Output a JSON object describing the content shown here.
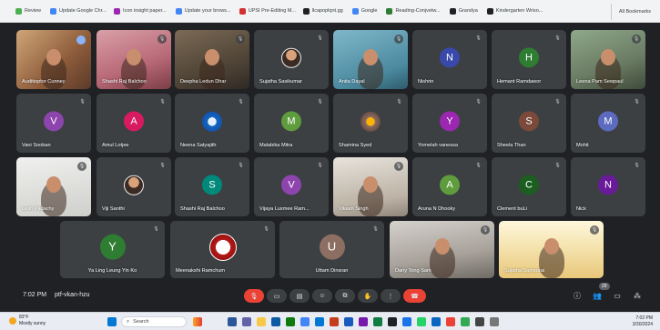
{
  "bookmarks": [
    {
      "label": "Review",
      "color": "#4caf50"
    },
    {
      "label": "Update Google Chr...",
      "color": "#4285f4"
    },
    {
      "label": "Icon insight paper...",
      "color": "#9c27b0"
    },
    {
      "label": "Update your brows...",
      "color": "#4285f4"
    },
    {
      "label": "UPSI Pre-Editing M...",
      "color": "#d32f2f"
    },
    {
      "label": "llcapoplqnt.gg",
      "color": "#202124"
    },
    {
      "label": "Google",
      "color": "#4285f4"
    },
    {
      "label": "Reading-Conjvetw...",
      "color": "#2e7d32"
    },
    {
      "label": "Grandya",
      "color": "#202124"
    },
    {
      "label": "Kindergarten Wriso...",
      "color": "#202124"
    }
  ],
  "all_bookmarks": "All Bookmarks",
  "participants": [
    {
      "name": "Auditioptor Cunney",
      "initial": "",
      "color": "",
      "video": "v-warm",
      "pin": true
    },
    {
      "name": "Shashi Raj Balchoo",
      "initial": "",
      "color": "",
      "video": "v-pink"
    },
    {
      "name": "Deepha Ledun Dhar",
      "initial": "",
      "color": "",
      "video": "v-room"
    },
    {
      "name": "Sujatha Sasikumar",
      "initial": "",
      "color": "",
      "video": "avatar-photo"
    },
    {
      "name": "Anita Dayal",
      "initial": "",
      "color": "",
      "video": "v-teal"
    },
    {
      "name": "Nishrin",
      "initial": "N",
      "color": "#3949ab"
    },
    {
      "name": "Hemant Ramdawor",
      "initial": "H",
      "color": "#2e7d32"
    },
    {
      "name": "Leena Pam Sewpaul",
      "initial": "",
      "color": "",
      "video": "v-plant"
    },
    {
      "name": "Vani Sooban",
      "initial": "V",
      "color": "#8e44ad"
    },
    {
      "name": "Amul Lotjee",
      "initial": "A",
      "color": "#d81b60"
    },
    {
      "name": "Neena Satyajith",
      "initial": "",
      "color": "",
      "video": "avatar-logo"
    },
    {
      "name": "Malabika Mitra",
      "initial": "M",
      "color": "#5f9c3d"
    },
    {
      "name": "Shamina Syed",
      "initial": "",
      "color": "",
      "video": "avatar-flower"
    },
    {
      "name": "Yomelah vanessa",
      "initial": "Y",
      "color": "#9c27b0"
    },
    {
      "name": "Sheela Than",
      "initial": "S",
      "color": "#7b4a3a"
    },
    {
      "name": "Mohit",
      "initial": "M",
      "color": "#5c6bc0"
    },
    {
      "name": "Lesh Padachy",
      "initial": "",
      "color": "",
      "video": "v-white"
    },
    {
      "name": "Viji Santhi",
      "initial": "",
      "color": "",
      "video": "avatar-photo2"
    },
    {
      "name": "Shashi Raj Balchoo",
      "initial": "S",
      "color": "#00897b"
    },
    {
      "name": "Vijaya Luxmee Ram...",
      "initial": "V",
      "color": "#8e44ad"
    },
    {
      "name": "Vikash Singh",
      "initial": "",
      "color": "",
      "video": "v-sofa"
    },
    {
      "name": "Aruna N Dhooky",
      "initial": "A",
      "color": "#5f9c3d"
    },
    {
      "name": "Clement buLi",
      "initial": "C",
      "color": "#1b5e20"
    },
    {
      "name": "Nick",
      "initial": "N",
      "color": "#6a1b9a"
    },
    {
      "name": "Ya Ling Leung Yin Ko",
      "initial": "Y",
      "color": "#2e7d32"
    },
    {
      "name": "Meenakshi Ramchum",
      "initial": "",
      "color": "",
      "video": "avatar-crest"
    },
    {
      "name": "Uttam Dinsran",
      "initial": "U",
      "color": "#8d6e63"
    },
    {
      "name": "Dany Tong Sam",
      "initial": "",
      "color": "",
      "video": "v-corr"
    },
    {
      "name": "Sujatha Samsurai",
      "initial": "",
      "color": "",
      "video": "v-poster"
    }
  ],
  "controls": {
    "time": "7:02 PM",
    "meeting_code": "ptf-vkan-hzu",
    "participant_count": "29"
  },
  "taskbar": {
    "weather_temp": "83°F",
    "weather_desc": "Mostly sunny",
    "search": "Search",
    "time": "7:02 PM",
    "date": "3/30/2024"
  }
}
